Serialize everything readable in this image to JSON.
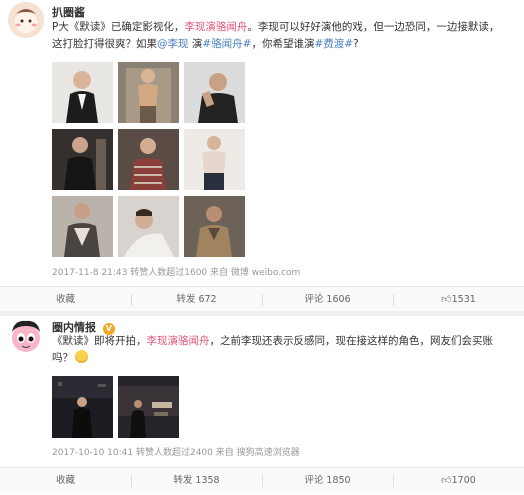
{
  "post1": {
    "author": "扒圈酱",
    "text_a": "P大《默读》已确定影视化，",
    "text_hl": "李现演骆闻舟",
    "text_b": "。李现可以好好演他的戏，但一边恐同，一边接默读，",
    "text_c": "这打脸打得很爽？如果",
    "mention": "@李现",
    "text_d": " 演",
    "tag1": "#骆闻舟#",
    "text_e": "，你希望谁演",
    "tag2": "#费渡#",
    "text_f": "?",
    "meta_time": "2017-11-8 21:43",
    "meta_reposts": "转赞人数超过1600",
    "meta_from": "来自 微博 weibo.com",
    "actions": {
      "fav": "收藏",
      "repost": "转发 672",
      "comment": "评论 1606",
      "like": "1531"
    }
  },
  "post2": {
    "author": "圈内情报",
    "badge": "V",
    "text_a": "《默读》即将开拍，",
    "text_hl": "李现演骆闻舟",
    "text_b": "，之前李现还表示反感同，现在接这样的角色，网友们会买账",
    "text_c": "吗？",
    "meta_time": "2017-10-10 10:41",
    "meta_reposts": "转赞人数超过2400",
    "meta_from": "来自 搜狗高速浏览器",
    "actions": {
      "fav": "收藏",
      "repost": "转发 1358",
      "comment": "评论 1850",
      "like": "1700"
    }
  },
  "colors": {
    "highlight": "#e0567a",
    "link": "#4a7fc1",
    "meta": "#999999"
  }
}
